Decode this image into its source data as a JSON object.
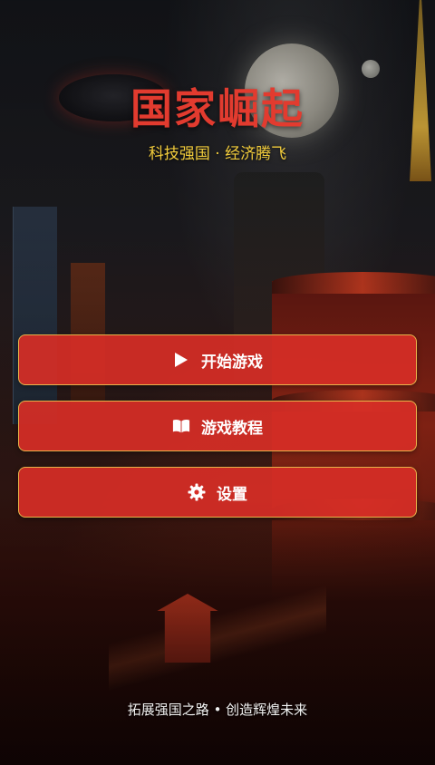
{
  "header": {
    "title": "国家崛起",
    "subtitle": "科技强国 · 经济腾飞"
  },
  "menu": {
    "buttons": [
      {
        "label": "开始游戏",
        "icon": "play-icon"
      },
      {
        "label": "游戏教程",
        "icon": "book-icon"
      },
      {
        "label": "设置",
        "icon": "gear-icon"
      }
    ]
  },
  "footer": {
    "tagline": "拓展强国之路 • 创造辉煌未来"
  },
  "colors": {
    "title": "#e23b2f",
    "subtitle": "#f3cd3c",
    "button_bg": "#d72e26",
    "button_border": "#e8b34a"
  }
}
